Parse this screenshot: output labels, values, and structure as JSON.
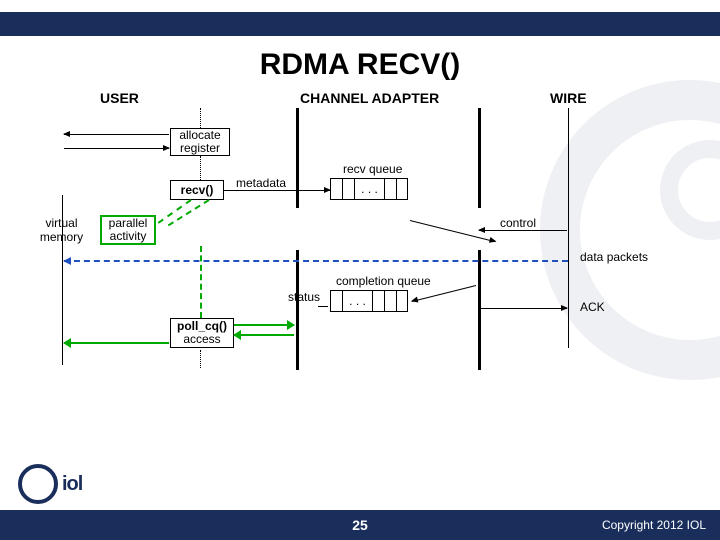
{
  "title": "RDMA RECV()",
  "lanes": {
    "user": "USER",
    "adapter": "CHANNEL ADAPTER",
    "wire": "WIRE"
  },
  "labels": {
    "allocate": "allocate",
    "register": "register",
    "recv": "recv()",
    "metadata": "metadata",
    "recv_queue": "recv queue",
    "dots": ". . .",
    "virtual_memory": "virtual\nmemory",
    "parallel_activity": "parallel\nactivity",
    "control": "control",
    "data_packets": "data packets",
    "completion_queue": "completion queue",
    "status": "status",
    "poll_cq": "poll_cq()",
    "access": "access",
    "ack": "ACK"
  },
  "footer": {
    "page": "25",
    "copyright": "Copyright 2012 IOL",
    "logo": "iol"
  }
}
